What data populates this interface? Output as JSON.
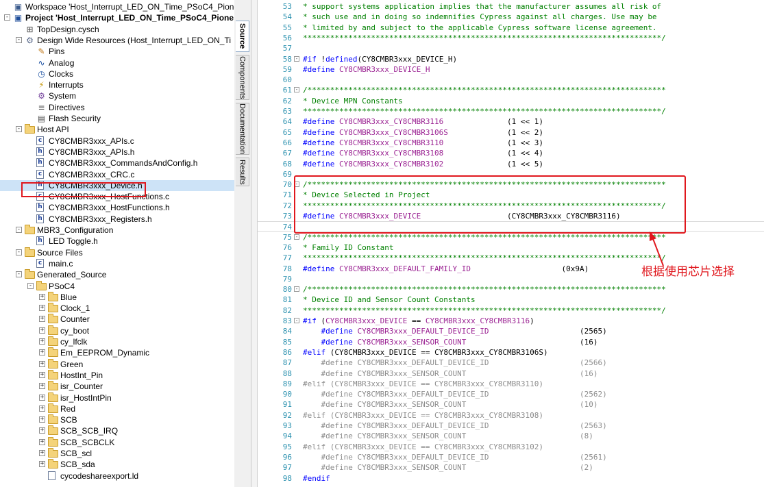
{
  "tree": {
    "rows": [
      {
        "indent": 0,
        "expander": "",
        "icon": "workspace",
        "label": "Workspace 'Host_Interrupt_LED_ON_Time_PSoC4_Pioneer",
        "bold": false
      },
      {
        "indent": 0,
        "expander": "-",
        "icon": "project",
        "label": "Project  'Host_Interrupt_LED_ON_Time_PSoC4_Pione",
        "bold": true
      },
      {
        "indent": 1,
        "expander": "",
        "icon": "schematic",
        "label": "TopDesign.cysch",
        "bold": false
      },
      {
        "indent": 1,
        "expander": "-",
        "icon": "dwr",
        "label": "Design Wide Resources (Host_Interrupt_LED_ON_Ti",
        "bold": false
      },
      {
        "indent": 2,
        "expander": "",
        "icon": "pins",
        "label": "Pins",
        "bold": false
      },
      {
        "indent": 2,
        "expander": "",
        "icon": "analog",
        "label": "Analog",
        "bold": false
      },
      {
        "indent": 2,
        "expander": "",
        "icon": "clock",
        "label": "Clocks",
        "bold": false
      },
      {
        "indent": 2,
        "expander": "",
        "icon": "interrupt",
        "label": "Interrupts",
        "bold": false
      },
      {
        "indent": 2,
        "expander": "",
        "icon": "system",
        "label": "System",
        "bold": false
      },
      {
        "indent": 2,
        "expander": "",
        "icon": "directive",
        "label": "Directives",
        "bold": false
      },
      {
        "indent": 2,
        "expander": "",
        "icon": "flash",
        "label": "Flash Security",
        "bold": false
      },
      {
        "indent": 1,
        "expander": "-",
        "icon": "folder",
        "label": "Host API",
        "bold": false
      },
      {
        "indent": 2,
        "expander": "",
        "icon": "c",
        "label": "CY8CMBR3xxx_APIs.c",
        "bold": false
      },
      {
        "indent": 2,
        "expander": "",
        "icon": "h",
        "label": "CY8CMBR3xxx_APIs.h",
        "bold": false
      },
      {
        "indent": 2,
        "expander": "",
        "icon": "h",
        "label": "CY8CMBR3xxx_CommandsAndConfig.h",
        "bold": false
      },
      {
        "indent": 2,
        "expander": "",
        "icon": "c",
        "label": "CY8CMBR3xxx_CRC.c",
        "bold": false
      },
      {
        "indent": 2,
        "expander": "",
        "icon": "h",
        "label": "CY8CMBR3xxx_Device.h",
        "bold": false,
        "selected": true
      },
      {
        "indent": 2,
        "expander": "",
        "icon": "c",
        "label": "CY8CMBR3xxx_HostFunctions.c",
        "bold": false
      },
      {
        "indent": 2,
        "expander": "",
        "icon": "h",
        "label": "CY8CMBR3xxx_HostFunctions.h",
        "bold": false
      },
      {
        "indent": 2,
        "expander": "",
        "icon": "h",
        "label": "CY8CMBR3xxx_Registers.h",
        "bold": false
      },
      {
        "indent": 1,
        "expander": "-",
        "icon": "folder",
        "label": "MBR3_Configuration",
        "bold": false
      },
      {
        "indent": 2,
        "expander": "",
        "icon": "h",
        "label": "LED Toggle.h",
        "bold": false
      },
      {
        "indent": 1,
        "expander": "-",
        "icon": "folder",
        "label": "Source Files",
        "bold": false
      },
      {
        "indent": 2,
        "expander": "",
        "icon": "c",
        "label": "main.c",
        "bold": false
      },
      {
        "indent": 1,
        "expander": "-",
        "icon": "folder",
        "label": "Generated_Source",
        "bold": false
      },
      {
        "indent": 2,
        "expander": "-",
        "icon": "folder",
        "label": "PSoC4",
        "bold": false
      },
      {
        "indent": 3,
        "expander": "+",
        "icon": "folder",
        "label": "Blue",
        "bold": false
      },
      {
        "indent": 3,
        "expander": "+",
        "icon": "folder",
        "label": "Clock_1",
        "bold": false
      },
      {
        "indent": 3,
        "expander": "+",
        "icon": "folder",
        "label": "Counter",
        "bold": false
      },
      {
        "indent": 3,
        "expander": "+",
        "icon": "folder",
        "label": "cy_boot",
        "bold": false
      },
      {
        "indent": 3,
        "expander": "+",
        "icon": "folder",
        "label": "cy_lfclk",
        "bold": false
      },
      {
        "indent": 3,
        "expander": "+",
        "icon": "folder",
        "label": "Em_EEPROM_Dynamic",
        "bold": false
      },
      {
        "indent": 3,
        "expander": "+",
        "icon": "folder",
        "label": "Green",
        "bold": false
      },
      {
        "indent": 3,
        "expander": "+",
        "icon": "folder",
        "label": "HostInt_Pin",
        "bold": false
      },
      {
        "indent": 3,
        "expander": "+",
        "icon": "folder",
        "label": "isr_Counter",
        "bold": false
      },
      {
        "indent": 3,
        "expander": "+",
        "icon": "folder",
        "label": "isr_HostIntPin",
        "bold": false
      },
      {
        "indent": 3,
        "expander": "+",
        "icon": "folder",
        "label": "Red",
        "bold": false
      },
      {
        "indent": 3,
        "expander": "+",
        "icon": "folder",
        "label": "SCB",
        "bold": false
      },
      {
        "indent": 3,
        "expander": "+",
        "icon": "folder",
        "label": "SCB_SCB_IRQ",
        "bold": false
      },
      {
        "indent": 3,
        "expander": "+",
        "icon": "folder",
        "label": "SCB_SCBCLK",
        "bold": false
      },
      {
        "indent": 3,
        "expander": "+",
        "icon": "folder",
        "label": "SCB_scl",
        "bold": false
      },
      {
        "indent": 3,
        "expander": "+",
        "icon": "folder",
        "label": "SCB_sda",
        "bold": false
      },
      {
        "indent": 3,
        "expander": "",
        "icon": "txt",
        "label": "cycodeshareexport.ld",
        "bold": false
      }
    ]
  },
  "side_tabs": [
    {
      "label": "Source",
      "active": true
    },
    {
      "label": "Components",
      "active": false
    },
    {
      "label": "Documentation",
      "active": false
    },
    {
      "label": "Results",
      "active": false
    }
  ],
  "editor": {
    "lines": [
      {
        "n": "53",
        "fold": "",
        "parts": [
          [
            "com",
            "* support systems application implies that the manufacturer assumes all risk of"
          ]
        ]
      },
      {
        "n": "54",
        "fold": "",
        "parts": [
          [
            "com",
            "* such use and in doing so indemnifies Cypress against all charges. Use may be"
          ]
        ]
      },
      {
        "n": "55",
        "fold": "",
        "parts": [
          [
            "com",
            "* limited by and subject to the applicable Cypress software license agreement."
          ]
        ]
      },
      {
        "n": "56",
        "fold": "",
        "parts": [
          [
            "com",
            "*******************************************************************************/"
          ]
        ]
      },
      {
        "n": "57",
        "fold": "",
        "parts": []
      },
      {
        "n": "58",
        "fold": "-",
        "parts": [
          [
            "pp",
            "#if "
          ],
          [
            "norm",
            "!"
          ],
          [
            "pp",
            "defined"
          ],
          [
            "norm",
            "(CY8CMBR3xxx_DEVICE_H)"
          ]
        ]
      },
      {
        "n": "59",
        "fold": "",
        "parts": [
          [
            "pp",
            "#define "
          ],
          [
            "mac",
            "CY8CMBR3xxx_DEVICE_H"
          ]
        ]
      },
      {
        "n": "60",
        "fold": "",
        "parts": []
      },
      {
        "n": "61",
        "fold": "-",
        "parts": [
          [
            "com",
            "/*******************************************************************************"
          ]
        ]
      },
      {
        "n": "62",
        "fold": "",
        "parts": [
          [
            "com",
            "* Device MPN Constants"
          ]
        ]
      },
      {
        "n": "63",
        "fold": "",
        "parts": [
          [
            "com",
            "*******************************************************************************/"
          ]
        ]
      },
      {
        "n": "64",
        "fold": "",
        "parts": [
          [
            "pp",
            "#define "
          ],
          [
            "mac",
            "CY8CMBR3xxx_CY8CMBR3116"
          ],
          [
            "norm",
            "              (1 << 1)"
          ]
        ]
      },
      {
        "n": "65",
        "fold": "",
        "parts": [
          [
            "pp",
            "#define "
          ],
          [
            "mac",
            "CY8CMBR3xxx_CY8CMBR3106S"
          ],
          [
            "norm",
            "             (1 << 2)"
          ]
        ]
      },
      {
        "n": "66",
        "fold": "",
        "parts": [
          [
            "pp",
            "#define "
          ],
          [
            "mac",
            "CY8CMBR3xxx_CY8CMBR3110"
          ],
          [
            "norm",
            "              (1 << 3)"
          ]
        ]
      },
      {
        "n": "67",
        "fold": "",
        "parts": [
          [
            "pp",
            "#define "
          ],
          [
            "mac",
            "CY8CMBR3xxx_CY8CMBR3108"
          ],
          [
            "norm",
            "              (1 << 4)"
          ]
        ]
      },
      {
        "n": "68",
        "fold": "",
        "parts": [
          [
            "pp",
            "#define "
          ],
          [
            "mac",
            "CY8CMBR3xxx_CY8CMBR3102"
          ],
          [
            "norm",
            "              (1 << 5)"
          ]
        ]
      },
      {
        "n": "69",
        "fold": "",
        "parts": []
      },
      {
        "n": "70",
        "fold": "-",
        "parts": [
          [
            "com",
            "/*******************************************************************************"
          ]
        ]
      },
      {
        "n": "71",
        "fold": "",
        "parts": [
          [
            "com",
            "* Device Selected in Project"
          ]
        ]
      },
      {
        "n": "72",
        "fold": "",
        "parts": [
          [
            "com",
            "*******************************************************************************/"
          ]
        ]
      },
      {
        "n": "73",
        "fold": "",
        "parts": [
          [
            "pp",
            "#define "
          ],
          [
            "mac",
            "CY8CMBR3xxx_DEVICE"
          ],
          [
            "norm",
            "                   (CY8CMBR3xxx_CY8CMBR3116)"
          ]
        ]
      },
      {
        "n": "74",
        "fold": "",
        "parts": [],
        "current": true
      },
      {
        "n": "75",
        "fold": "-",
        "parts": [
          [
            "com",
            "/*******************************************************************************"
          ]
        ]
      },
      {
        "n": "76",
        "fold": "",
        "parts": [
          [
            "com",
            "* Family ID Constant"
          ]
        ]
      },
      {
        "n": "77",
        "fold": "",
        "parts": [
          [
            "com",
            "*******************************************************************************/"
          ]
        ]
      },
      {
        "n": "78",
        "fold": "",
        "parts": [
          [
            "pp",
            "#define "
          ],
          [
            "mac",
            "CY8CMBR3xxx_DEFAULT_FAMILY_ID"
          ],
          [
            "norm",
            "                    (0x9A)"
          ]
        ]
      },
      {
        "n": "79",
        "fold": "",
        "parts": []
      },
      {
        "n": "80",
        "fold": "-",
        "parts": [
          [
            "com",
            "/*******************************************************************************"
          ]
        ]
      },
      {
        "n": "81",
        "fold": "",
        "parts": [
          [
            "com",
            "* Device ID and Sensor Count Constants"
          ]
        ]
      },
      {
        "n": "82",
        "fold": "",
        "parts": [
          [
            "com",
            "*******************************************************************************/"
          ]
        ]
      },
      {
        "n": "83",
        "fold": "-",
        "parts": [
          [
            "pp",
            "#if "
          ],
          [
            "norm",
            "("
          ],
          [
            "mac",
            "CY8CMBR3xxx_DEVICE"
          ],
          [
            "norm",
            " == "
          ],
          [
            "mac",
            "CY8CMBR3xxx_CY8CMBR3116"
          ],
          [
            "norm",
            ")"
          ]
        ]
      },
      {
        "n": "84",
        "fold": "",
        "parts": [
          [
            "pp",
            "    #define "
          ],
          [
            "mac",
            "CY8CMBR3xxx_DEFAULT_DEVICE_ID"
          ],
          [
            "norm",
            "                    (2565)"
          ]
        ]
      },
      {
        "n": "85",
        "fold": "",
        "parts": [
          [
            "pp",
            "    #define "
          ],
          [
            "mac",
            "CY8CMBR3xxx_SENSOR_COUNT"
          ],
          [
            "norm",
            "                         (16)"
          ]
        ]
      },
      {
        "n": "86",
        "fold": "",
        "parts": [
          [
            "pp",
            "#elif "
          ],
          [
            "norm",
            "(CY8CMBR3xxx_DEVICE == CY8CMBR3xxx_CY8CMBR3106S)"
          ]
        ]
      },
      {
        "n": "87",
        "fold": "",
        "parts": [
          [
            "inact",
            "    #define CY8CMBR3xxx_DEFAULT_DEVICE_ID                    (2566)"
          ]
        ]
      },
      {
        "n": "88",
        "fold": "",
        "parts": [
          [
            "inact",
            "    #define CY8CMBR3xxx_SENSOR_COUNT                         (16)"
          ]
        ]
      },
      {
        "n": "89",
        "fold": "",
        "parts": [
          [
            "inact",
            "#elif (CY8CMBR3xxx_DEVICE == CY8CMBR3xxx_CY8CMBR3110)"
          ]
        ]
      },
      {
        "n": "90",
        "fold": "",
        "parts": [
          [
            "inact",
            "    #define CY8CMBR3xxx_DEFAULT_DEVICE_ID                    (2562)"
          ]
        ]
      },
      {
        "n": "91",
        "fold": "",
        "parts": [
          [
            "inact",
            "    #define CY8CMBR3xxx_SENSOR_COUNT                         (10)"
          ]
        ]
      },
      {
        "n": "92",
        "fold": "",
        "parts": [
          [
            "inact",
            "#elif (CY8CMBR3xxx_DEVICE == CY8CMBR3xxx_CY8CMBR3108)"
          ]
        ]
      },
      {
        "n": "93",
        "fold": "",
        "parts": [
          [
            "inact",
            "    #define CY8CMBR3xxx_DEFAULT_DEVICE_ID                    (2563)"
          ]
        ]
      },
      {
        "n": "94",
        "fold": "",
        "parts": [
          [
            "inact",
            "    #define CY8CMBR3xxx_SENSOR_COUNT                         (8)"
          ]
        ]
      },
      {
        "n": "95",
        "fold": "",
        "parts": [
          [
            "inact",
            "#elif (CY8CMBR3xxx_DEVICE == CY8CMBR3xxx_CY8CMBR3102)"
          ]
        ]
      },
      {
        "n": "96",
        "fold": "",
        "parts": [
          [
            "inact",
            "    #define CY8CMBR3xxx_DEFAULT_DEVICE_ID                    (2561)"
          ]
        ]
      },
      {
        "n": "97",
        "fold": "",
        "parts": [
          [
            "inact",
            "    #define CY8CMBR3xxx_SENSOR_COUNT                         (2)"
          ]
        ]
      },
      {
        "n": "98",
        "fold": "",
        "parts": [
          [
            "pp",
            "#endif"
          ]
        ]
      }
    ]
  },
  "annotation": {
    "text": "根据使用芯片选择",
    "color": "#e0171d"
  }
}
